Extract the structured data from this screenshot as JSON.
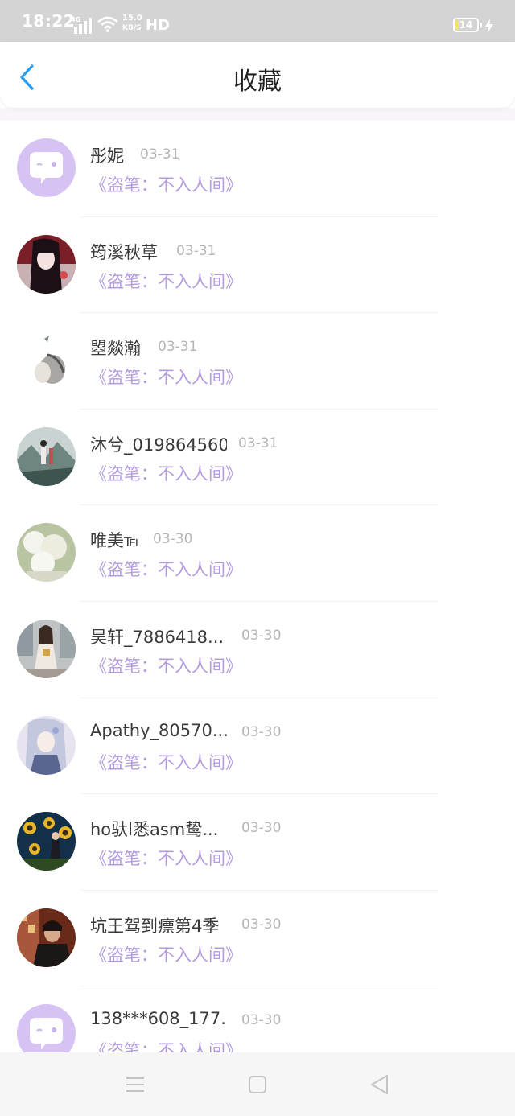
{
  "status_bar": {
    "time": "18:22",
    "network_type": "4G",
    "speed_value": "15.0",
    "speed_unit": "KB/S",
    "hd_label": "HD",
    "battery_level": "14",
    "battery_fraction": 0.14
  },
  "header": {
    "title": "收藏",
    "back_icon": "chevron-left-icon"
  },
  "colors": {
    "accent": "#2a9df4",
    "book_title": "#b39be0",
    "default_avatar_bg": "#d6c3f3"
  },
  "favorites": [
    {
      "username": "彤妮",
      "date": "03-31",
      "book": "《盗笔：不入人间》",
      "avatar": "default-chat-avatar"
    },
    {
      "username": "筠溪秋草",
      "date": "03-31",
      "book": "《盗笔：不入人间》",
      "avatar": "anime-girl-avatar"
    },
    {
      "username": "曌燚瀚",
      "date": "03-31",
      "book": "《盗笔：不入人间》",
      "avatar": "ink-sketch-avatar"
    },
    {
      "username": "沐兮_019864560",
      "date": "03-31",
      "book": "《盗笔：不入人间》",
      "avatar": "landscape-avatar"
    },
    {
      "username": "唯美℡",
      "date": "03-30",
      "book": "《盗笔：不入人间》",
      "avatar": "flower-avatar"
    },
    {
      "username": "昊轩_7886418...",
      "date": "03-30",
      "book": "《盗笔：不入人间》",
      "avatar": "photo-girl-avatar"
    },
    {
      "username": "Apathy_80570...",
      "date": "03-30",
      "book": "《盗笔：不入人间》",
      "avatar": "silver-hair-avatar"
    },
    {
      "username": "ho驮l悉asm鸷...",
      "date": "03-30",
      "book": "《盗笔：不入人间》",
      "avatar": "sunflower-avatar"
    },
    {
      "username": "坑王驾到瘭第4季",
      "date": "03-30",
      "book": "《盗笔：不入人间》",
      "avatar": "dark-portrait-avatar"
    },
    {
      "username": "138***608_177...",
      "date": "03-30",
      "book": "《盗笔：不入人间》",
      "avatar": "default-chat-avatar"
    }
  ],
  "nav_bar": {
    "menu_icon": "menu-icon",
    "home_icon": "square-home-icon",
    "back_icon": "triangle-back-icon"
  }
}
